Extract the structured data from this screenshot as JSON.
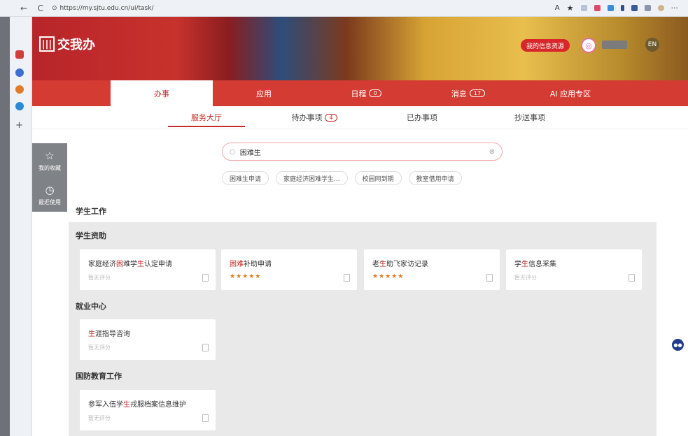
{
  "browser": {
    "url": "https://my.sjtu.edu.cn/ui/task/",
    "back_icon": "←",
    "refresh_icon": "C"
  },
  "header": {
    "logo_text": "交我办",
    "logo_mark": "|||",
    "info_button": "我的信息资源",
    "lang_button": "EN"
  },
  "main_tabs": [
    {
      "label": "办事",
      "badge": ""
    },
    {
      "label": "应用",
      "badge": ""
    },
    {
      "label": "日程",
      "badge": "0"
    },
    {
      "label": "消息",
      "badge": "17"
    },
    {
      "label": "AI 应用专区",
      "badge": ""
    }
  ],
  "sub_tabs": [
    {
      "label": "服务大厅",
      "badge": ""
    },
    {
      "label": "待办事项",
      "badge": "4"
    },
    {
      "label": "已办事项",
      "badge": ""
    },
    {
      "label": "抄送事项",
      "badge": ""
    }
  ],
  "quick_panel": {
    "favorites": "我的收藏",
    "recent": "最近使用"
  },
  "search": {
    "value": "困难生"
  },
  "suggestions": [
    "困难生申请",
    "家庭经济困难学生...",
    "校园网到期",
    "教室借用申请"
  ],
  "sections": {
    "student_work": "学生工作",
    "student_aid": "学生资助",
    "employment": "就业中心",
    "defense": "国防教育工作"
  },
  "cards": {
    "aid": [
      {
        "pre": "家庭经济",
        "hl1": "困",
        "mid": "难学",
        "hl2": "生",
        "post": "认定申请",
        "sub": "暂无评分",
        "stars": ""
      },
      {
        "pre": "",
        "hl1": "困难",
        "mid": "补助申请",
        "hl2": "",
        "post": "",
        "sub": "",
        "stars": "★★★★★"
      },
      {
        "pre": "老",
        "hl1": "生",
        "mid": "助飞家访记录",
        "hl2": "",
        "post": "",
        "sub": "",
        "stars": "★★★★★"
      },
      {
        "pre": "学",
        "hl1": "生",
        "mid": "信息采集",
        "hl2": "",
        "post": "",
        "sub": "暂无评分",
        "stars": ""
      }
    ],
    "employment": [
      {
        "pre": "",
        "hl1": "生",
        "mid": "涯指导咨询",
        "hl2": "",
        "post": "",
        "sub": "暂无评分",
        "stars": ""
      }
    ],
    "defense": [
      {
        "pre": "参军入伍学",
        "hl1": "生",
        "mid": "戎服档案信息维护",
        "hl2": "",
        "post": "",
        "sub": "暂无评分",
        "stars": ""
      }
    ]
  },
  "colors": {
    "accent": "#c52a28",
    "nav_bg": "#d43b33"
  }
}
